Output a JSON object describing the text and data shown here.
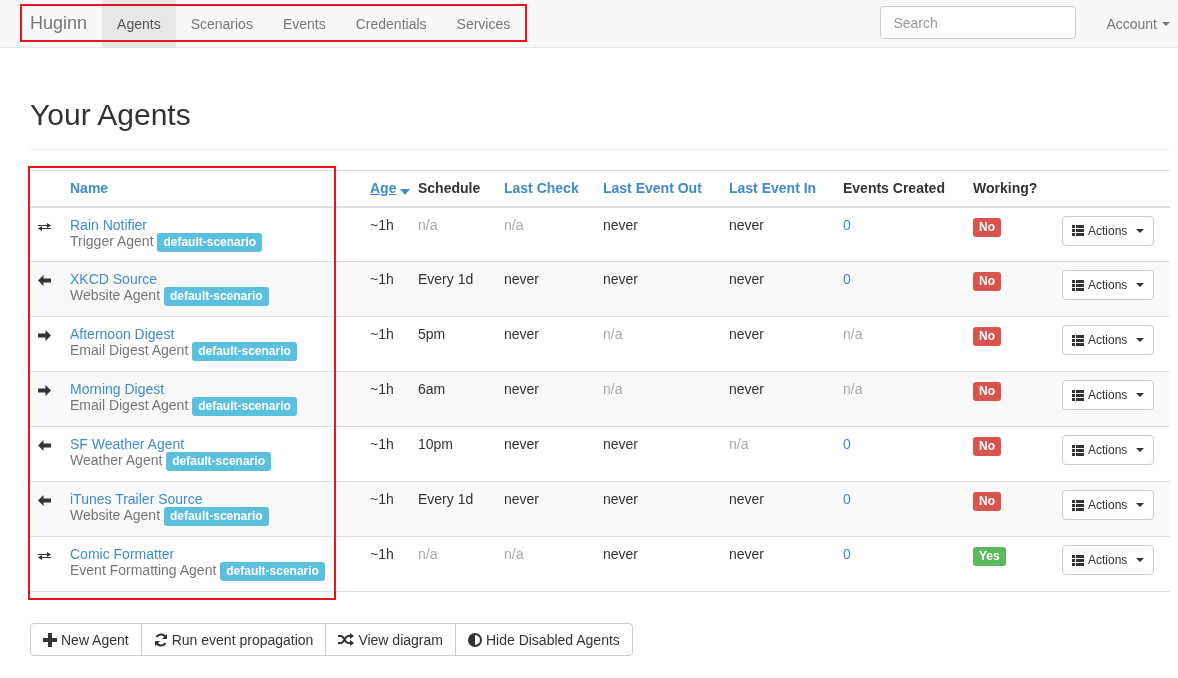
{
  "navbar": {
    "brand": "Huginn",
    "items": [
      {
        "label": "Agents",
        "selected": true
      },
      {
        "label": "Scenarios",
        "selected": false
      },
      {
        "label": "Events",
        "selected": false
      },
      {
        "label": "Credentials",
        "selected": false
      },
      {
        "label": "Services",
        "selected": false
      }
    ],
    "search": {
      "placeholder": "Search"
    },
    "account": "Account"
  },
  "page": {
    "title": "Your Agents"
  },
  "table": {
    "columns": [
      {
        "label": "Name",
        "sortable": true,
        "sorted": false
      },
      {
        "label": "Age",
        "sortable": true,
        "sorted": true
      },
      {
        "label": "Schedule",
        "sortable": false,
        "sorted": false
      },
      {
        "label": "Last Check",
        "sortable": true,
        "sorted": false
      },
      {
        "label": "Last Event Out",
        "sortable": true,
        "sorted": false
      },
      {
        "label": "Last Event In",
        "sortable": true,
        "sorted": false
      },
      {
        "label": "Events Created",
        "sortable": false,
        "sorted": false
      },
      {
        "label": "Working?",
        "sortable": false,
        "sorted": false
      }
    ],
    "rows": [
      {
        "kind": "both",
        "name": "Rain Notifier",
        "type": "Trigger Agent",
        "scenario": "default-scenario",
        "age": "~1h",
        "schedule": {
          "text": "n/a",
          "muted": true
        },
        "last_check": {
          "text": "n/a",
          "muted": true
        },
        "last_event_out": {
          "text": "never",
          "muted": false
        },
        "last_event_in": {
          "text": "never",
          "muted": false
        },
        "events_created": {
          "text": "0",
          "muted": false
        },
        "working": {
          "text": "No",
          "ok": false
        },
        "actions": "Actions"
      },
      {
        "kind": "in",
        "name": "XKCD Source",
        "type": "Website Agent",
        "scenario": "default-scenario",
        "age": "~1h",
        "schedule": {
          "text": "Every 1d",
          "muted": false
        },
        "last_check": {
          "text": "never",
          "muted": false
        },
        "last_event_out": {
          "text": "never",
          "muted": false
        },
        "last_event_in": {
          "text": "never",
          "muted": false
        },
        "events_created": {
          "text": "0",
          "muted": false
        },
        "working": {
          "text": "No",
          "ok": false
        },
        "actions": "Actions"
      },
      {
        "kind": "out",
        "name": "Afternoon Digest",
        "type": "Email Digest Agent",
        "scenario": "default-scenario",
        "age": "~1h",
        "schedule": {
          "text": "5pm",
          "muted": false
        },
        "last_check": {
          "text": "never",
          "muted": false
        },
        "last_event_out": {
          "text": "n/a",
          "muted": true
        },
        "last_event_in": {
          "text": "never",
          "muted": false
        },
        "events_created": {
          "text": "n/a",
          "muted": true
        },
        "working": {
          "text": "No",
          "ok": false
        },
        "actions": "Actions"
      },
      {
        "kind": "out",
        "name": "Morning Digest",
        "type": "Email Digest Agent",
        "scenario": "default-scenario",
        "age": "~1h",
        "schedule": {
          "text": "6am",
          "muted": false
        },
        "last_check": {
          "text": "never",
          "muted": false
        },
        "last_event_out": {
          "text": "n/a",
          "muted": true
        },
        "last_event_in": {
          "text": "never",
          "muted": false
        },
        "events_created": {
          "text": "n/a",
          "muted": true
        },
        "working": {
          "text": "No",
          "ok": false
        },
        "actions": "Actions"
      },
      {
        "kind": "in",
        "name": "SF Weather Agent",
        "type": "Weather Agent",
        "scenario": "default-scenario",
        "age": "~1h",
        "schedule": {
          "text": "10pm",
          "muted": false
        },
        "last_check": {
          "text": "never",
          "muted": false
        },
        "last_event_out": {
          "text": "never",
          "muted": false
        },
        "last_event_in": {
          "text": "n/a",
          "muted": true
        },
        "events_created": {
          "text": "0",
          "muted": false
        },
        "working": {
          "text": "No",
          "ok": false
        },
        "actions": "Actions"
      },
      {
        "kind": "in",
        "name": "iTunes Trailer Source",
        "type": "Website Agent",
        "scenario": "default-scenario",
        "age": "~1h",
        "schedule": {
          "text": "Every 1d",
          "muted": false
        },
        "last_check": {
          "text": "never",
          "muted": false
        },
        "last_event_out": {
          "text": "never",
          "muted": false
        },
        "last_event_in": {
          "text": "never",
          "muted": false
        },
        "events_created": {
          "text": "0",
          "muted": false
        },
        "working": {
          "text": "No",
          "ok": false
        },
        "actions": "Actions"
      },
      {
        "kind": "both",
        "name": "Comic Formatter",
        "type": "Event Formatting Agent",
        "scenario": "default-scenario",
        "age": "~1h",
        "schedule": {
          "text": "n/a",
          "muted": true
        },
        "last_check": {
          "text": "n/a",
          "muted": true
        },
        "last_event_out": {
          "text": "never",
          "muted": false
        },
        "last_event_in": {
          "text": "never",
          "muted": false
        },
        "events_created": {
          "text": "0",
          "muted": false
        },
        "working": {
          "text": "Yes",
          "ok": true
        },
        "actions": "Actions"
      }
    ]
  },
  "buttons": [
    {
      "kind": "plus",
      "label": "New Agent"
    },
    {
      "kind": "refresh",
      "label": "Run event propagation"
    },
    {
      "kind": "shuffle",
      "label": "View diagram"
    },
    {
      "kind": "contrast",
      "label": "Hide Disabled Agents"
    }
  ]
}
